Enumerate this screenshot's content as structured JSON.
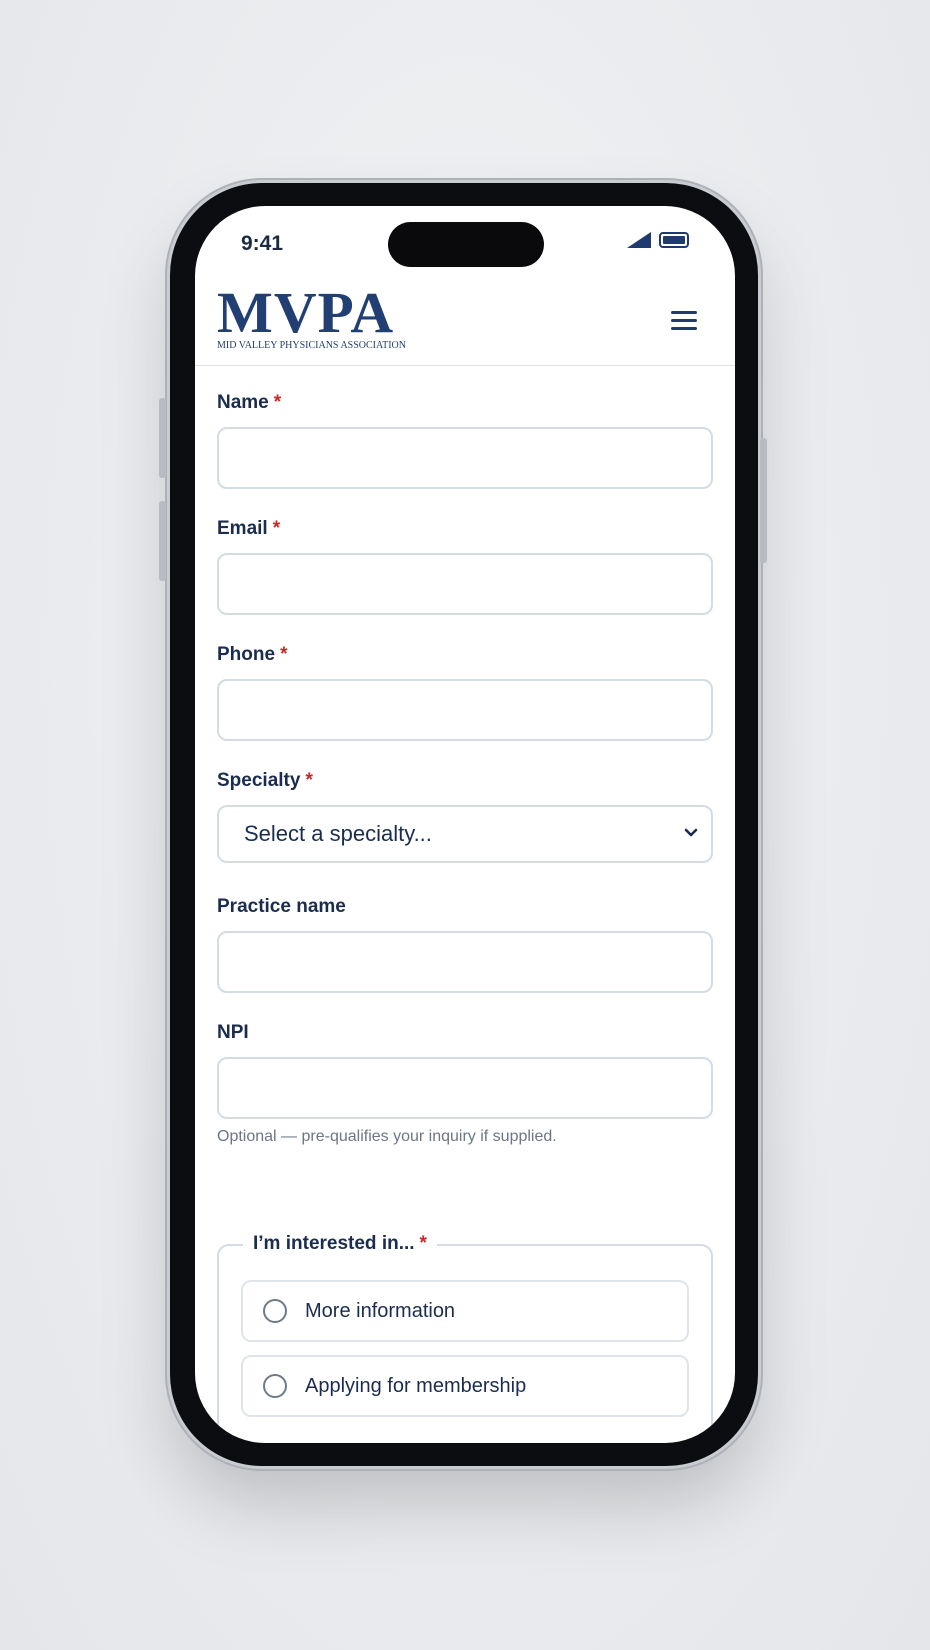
{
  "status_bar": {
    "time": "9:41"
  },
  "header": {
    "logo_mark": "MVPA",
    "logo_subtitle": "MID VALLEY PHYSICIANS ASSOCIATION",
    "menu_icon": "hamburger-menu-icon"
  },
  "form": {
    "name": {
      "label": "Name",
      "required_marker": "*",
      "value": ""
    },
    "email": {
      "label": "Email",
      "required_marker": "*",
      "value": ""
    },
    "phone": {
      "label": "Phone",
      "required_marker": "*",
      "value": ""
    },
    "specialty": {
      "label": "Specialty",
      "required_marker": "*",
      "selected": "Select a specialty..."
    },
    "practice_name": {
      "label": "Practice name",
      "value": ""
    },
    "npi": {
      "label": "NPI",
      "value": "",
      "helper": "Optional — pre-qualifies your inquiry if supplied."
    },
    "interest": {
      "legend": "I’m interested in...",
      "required_marker": "*",
      "options": [
        {
          "label": "More information"
        },
        {
          "label": "Applying for membership"
        }
      ]
    }
  },
  "colors": {
    "brand": "#213f73",
    "required": "#c62828",
    "text": "#1b2d4f",
    "border": "#d4dbe3"
  }
}
